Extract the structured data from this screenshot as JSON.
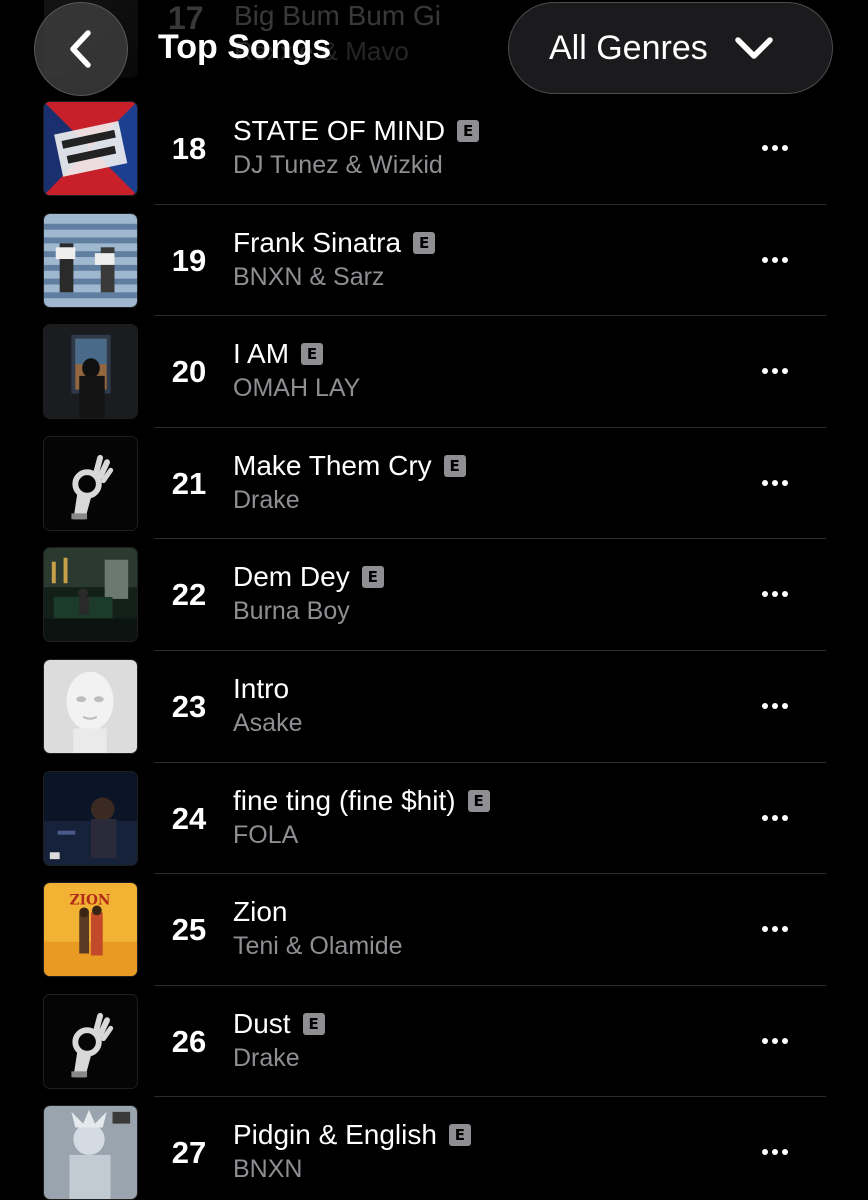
{
  "header": {
    "title": "Top Songs",
    "genre_label": "All Genres",
    "back_icon": "chevron-left-icon",
    "dropdown_icon": "chevron-down-icon"
  },
  "previous_row": {
    "rank": "17",
    "title": "Big Bum Bum Gi",
    "artist": "Rexxie & Mavo"
  },
  "explicit_badge": "E",
  "songs": [
    {
      "rank": "18",
      "title": "STATE OF MIND",
      "artist": "DJ Tunez & Wizkid",
      "explicit": true
    },
    {
      "rank": "19",
      "title": "Frank Sinatra",
      "artist": "BNXN & Sarz",
      "explicit": true
    },
    {
      "rank": "20",
      "title": "I AM",
      "artist": "OMAH LAY",
      "explicit": true
    },
    {
      "rank": "21",
      "title": "Make Them Cry",
      "artist": "Drake",
      "explicit": true
    },
    {
      "rank": "22",
      "title": "Dem Dey",
      "artist": "Burna Boy",
      "explicit": true
    },
    {
      "rank": "23",
      "title": "Intro",
      "artist": "Asake",
      "explicit": false
    },
    {
      "rank": "24",
      "title": "fine ting (fine $hit)",
      "artist": "FOLA",
      "explicit": true
    },
    {
      "rank": "25",
      "title": "Zion",
      "artist": "Teni & Olamide",
      "explicit": false
    },
    {
      "rank": "26",
      "title": "Dust",
      "artist": "Drake",
      "explicit": true
    },
    {
      "rank": "27",
      "title": "Pidgin & English",
      "artist": "BNXN",
      "explicit": true
    }
  ],
  "colors": {
    "background": "#000000",
    "secondary_text": "#8e8e93",
    "divider": "#2c2c2e",
    "badge": "#8e8e93"
  }
}
